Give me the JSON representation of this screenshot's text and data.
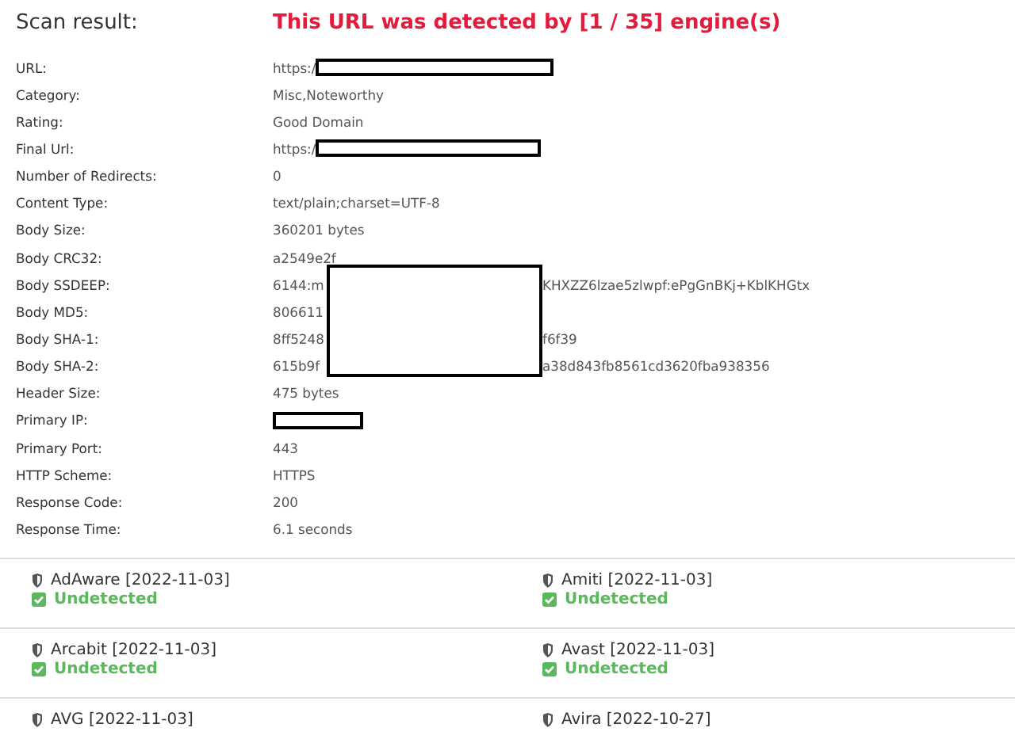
{
  "scan_result": {
    "label": "Scan result:",
    "verdict": "This URL was detected by [1 / 35] engine(s)"
  },
  "details": [
    {
      "label": "URL:",
      "parts": [
        {
          "kind": "text",
          "text": "https:/"
        },
        {
          "kind": "redaction"
        }
      ]
    },
    {
      "label": "Category:",
      "parts": [
        {
          "kind": "text",
          "text": "Misc,Noteworthy"
        }
      ]
    },
    {
      "label": "Rating:",
      "parts": [
        {
          "kind": "text",
          "text": "Good Domain"
        }
      ]
    },
    {
      "label": "Final Url:",
      "parts": [
        {
          "kind": "text",
          "text": "https:/"
        },
        {
          "kind": "redaction"
        }
      ]
    },
    {
      "label": "Number of Redirects:",
      "parts": [
        {
          "kind": "text",
          "text": "0"
        }
      ]
    },
    {
      "label": "Content Type:",
      "parts": [
        {
          "kind": "text",
          "text": "text/plain;charset=UTF-8"
        }
      ]
    },
    {
      "label": "Body Size:",
      "parts": [
        {
          "kind": "text",
          "text": "360201 bytes"
        }
      ]
    },
    {
      "label": "Body CRC32:",
      "parts": [
        {
          "kind": "text",
          "text": "a2549e2f"
        }
      ]
    },
    {
      "label": "Body SSDEEP:",
      "parts": [
        {
          "kind": "text",
          "text": "6144:m"
        },
        {
          "kind": "covered"
        },
        {
          "kind": "text",
          "text": "KHXZZ6lzae5zlwpf:ePgGnBKj+KblKHGtx"
        }
      ]
    },
    {
      "label": "Body MD5:",
      "parts": [
        {
          "kind": "text",
          "text": "806611"
        },
        {
          "kind": "covered"
        }
      ]
    },
    {
      "label": "Body SHA-1:",
      "parts": [
        {
          "kind": "text",
          "text": "8ff5248"
        },
        {
          "kind": "covered"
        },
        {
          "kind": "text",
          "text": "f6f39"
        }
      ]
    },
    {
      "label": "Body SHA-2:",
      "parts": [
        {
          "kind": "text",
          "text": "615b9f"
        },
        {
          "kind": "covered"
        },
        {
          "kind": "text",
          "text": "a38d843fb8561cd3620fba938356"
        }
      ]
    },
    {
      "label": "Header Size:",
      "parts": [
        {
          "kind": "text",
          "text": "475 bytes"
        }
      ]
    },
    {
      "label": "Primary IP:",
      "parts": [
        {
          "kind": "redaction"
        }
      ]
    },
    {
      "label": "Primary Port:",
      "parts": [
        {
          "kind": "text",
          "text": "443"
        }
      ]
    },
    {
      "label": "HTTP Scheme:",
      "parts": [
        {
          "kind": "text",
          "text": "HTTPS"
        }
      ]
    },
    {
      "label": "Response Code:",
      "parts": [
        {
          "kind": "text",
          "text": "200"
        }
      ]
    },
    {
      "label": "Response Time:",
      "parts": [
        {
          "kind": "text",
          "text": "6.1 seconds"
        }
      ]
    }
  ],
  "engines": [
    {
      "name": "AdAware [2022-11-03]",
      "status": "Undetected"
    },
    {
      "name": "Amiti [2022-11-03]",
      "status": "Undetected"
    },
    {
      "name": "Arcabit [2022-11-03]",
      "status": "Undetected"
    },
    {
      "name": "Avast [2022-11-03]",
      "status": "Undetected"
    },
    {
      "name": "AVG [2022-11-03]"
    },
    {
      "name": "Avira [2022-10-27]"
    }
  ]
}
